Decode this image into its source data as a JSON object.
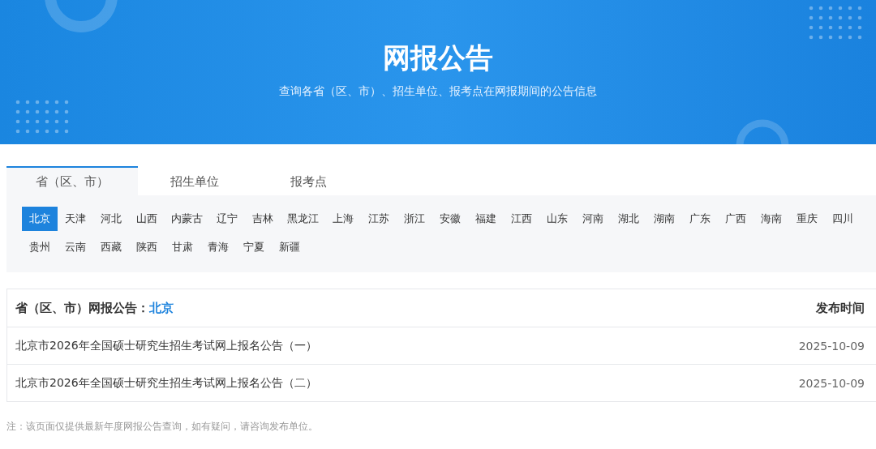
{
  "banner": {
    "title": "网报公告",
    "subtitle": "查询各省（区、市）、招生单位、报考点在网报期间的公告信息"
  },
  "tabs": [
    {
      "label": "省（区、市）",
      "selected": true
    },
    {
      "label": "招生单位",
      "selected": false
    },
    {
      "label": "报考点",
      "selected": false
    }
  ],
  "provinces": [
    {
      "label": "北京",
      "selected": true
    },
    {
      "label": "天津",
      "selected": false
    },
    {
      "label": "河北",
      "selected": false
    },
    {
      "label": "山西",
      "selected": false
    },
    {
      "label": "内蒙古",
      "selected": false
    },
    {
      "label": "辽宁",
      "selected": false
    },
    {
      "label": "吉林",
      "selected": false
    },
    {
      "label": "黑龙江",
      "selected": false
    },
    {
      "label": "上海",
      "selected": false
    },
    {
      "label": "江苏",
      "selected": false
    },
    {
      "label": "浙江",
      "selected": false
    },
    {
      "label": "安徽",
      "selected": false
    },
    {
      "label": "福建",
      "selected": false
    },
    {
      "label": "江西",
      "selected": false
    },
    {
      "label": "山东",
      "selected": false
    },
    {
      "label": "河南",
      "selected": false
    },
    {
      "label": "湖北",
      "selected": false
    },
    {
      "label": "湖南",
      "selected": false
    },
    {
      "label": "广东",
      "selected": false
    },
    {
      "label": "广西",
      "selected": false
    },
    {
      "label": "海南",
      "selected": false
    },
    {
      "label": "重庆",
      "selected": false
    },
    {
      "label": "四川",
      "selected": false
    },
    {
      "label": "贵州",
      "selected": false
    },
    {
      "label": "云南",
      "selected": false
    },
    {
      "label": "西藏",
      "selected": false
    },
    {
      "label": "陕西",
      "selected": false
    },
    {
      "label": "甘肃",
      "selected": false
    },
    {
      "label": "青海",
      "selected": false
    },
    {
      "label": "宁夏",
      "selected": false
    },
    {
      "label": "新疆",
      "selected": false
    }
  ],
  "table": {
    "heading": "省（区、市）网报公告：",
    "region": "北京",
    "date_heading": "发布时间",
    "rows": [
      {
        "title": "北京市2026年全国硕士研究生招生考试网上报名公告（一）",
        "date": "2025-10-09"
      },
      {
        "title": "北京市2026年全国硕士研究生招生考试网上报名公告（二）",
        "date": "2025-10-09"
      }
    ]
  },
  "note": "注：该页面仅提供最新年度网报公告查询，如有疑问，请咨询发布单位。"
}
